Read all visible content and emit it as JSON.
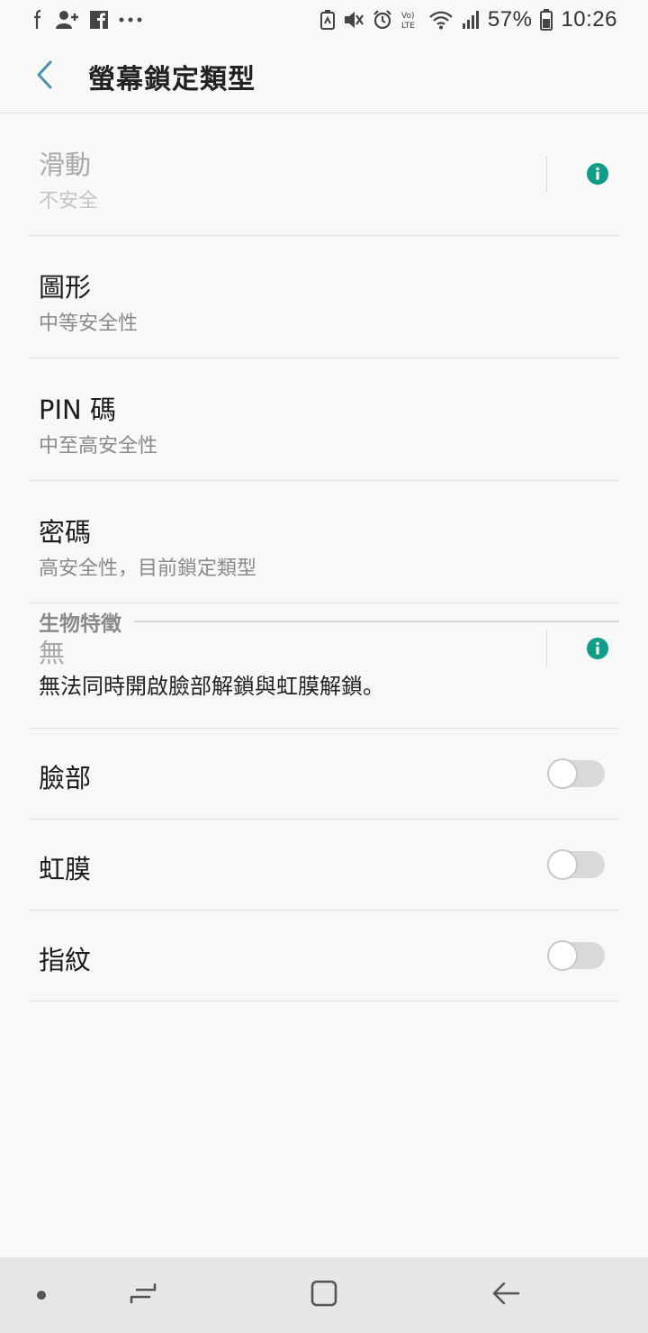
{
  "status_bar": {
    "battery_percent": "57%",
    "time": "10:26",
    "icons_left": [
      "notification-f-icon",
      "add-person-icon",
      "facebook-icon",
      "more-dots-icon"
    ],
    "icons_right": [
      "battery-saver-icon",
      "mute-icon",
      "alarm-icon",
      "volte-icon",
      "wifi-icon",
      "signal-icon",
      "battery-icon"
    ]
  },
  "app_bar": {
    "title": "螢幕鎖定類型"
  },
  "lock_options": [
    {
      "title": "滑動",
      "subtitle": "不安全",
      "enabled": false,
      "has_info": true
    },
    {
      "title": "圖形",
      "subtitle": "中等安全性",
      "enabled": true,
      "has_info": false
    },
    {
      "title": "PIN 碼",
      "subtitle": "中至高安全性",
      "enabled": true,
      "has_info": false
    },
    {
      "title": "密碼",
      "subtitle": "高安全性，目前鎖定類型",
      "enabled": true,
      "has_info": false
    },
    {
      "title": "無",
      "subtitle": "",
      "enabled": false,
      "has_info": true
    }
  ],
  "biometrics": {
    "section_label": "生物特徵",
    "notice": "無法同時開啟臉部解鎖與虹膜解鎖。",
    "toggles": [
      {
        "label": "臉部",
        "on": false
      },
      {
        "label": "虹膜",
        "on": false
      },
      {
        "label": "指紋",
        "on": false
      }
    ]
  },
  "colors": {
    "accent": "#4a90b0",
    "info": "#0f9d8a",
    "background": "#f8f8f8",
    "nav_bar": "#e6e6e6"
  }
}
